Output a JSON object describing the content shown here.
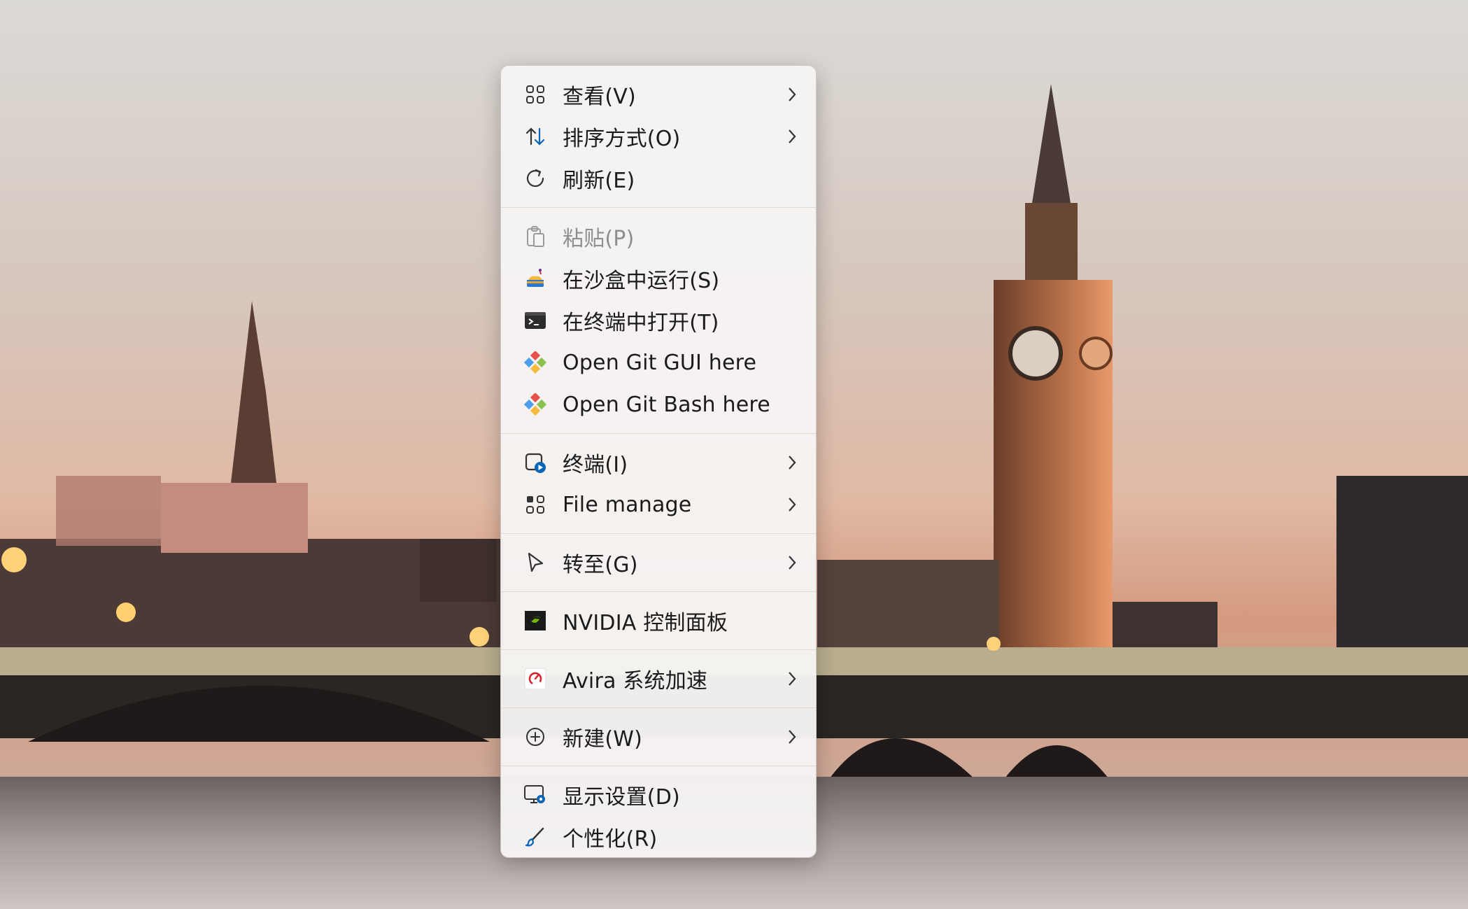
{
  "context_menu": {
    "groups": [
      {
        "items": [
          {
            "label": "查看(V)",
            "icon": "view-grid-icon",
            "submenu": true
          },
          {
            "label": "排序方式(O)",
            "icon": "sort-arrows-icon",
            "submenu": true
          },
          {
            "label": "刷新(E)",
            "icon": "refresh-icon",
            "submenu": false
          }
        ]
      },
      {
        "items": [
          {
            "label": "粘贴(P)",
            "icon": "paste-icon",
            "submenu": false,
            "disabled": true
          },
          {
            "label": "在沙盒中运行(S)",
            "icon": "sandbox-icon",
            "submenu": false
          },
          {
            "label": "在终端中打开(T)",
            "icon": "terminal-icon",
            "submenu": false
          },
          {
            "label": "Open Git GUI here",
            "icon": "git-icon",
            "submenu": false
          },
          {
            "label": "Open Git Bash here",
            "icon": "git-icon",
            "submenu": false
          }
        ]
      },
      {
        "items": [
          {
            "label": "终端(I)",
            "icon": "terminal-play-icon",
            "submenu": true
          },
          {
            "label": "File manage",
            "icon": "file-manage-grid-icon",
            "submenu": true
          }
        ]
      },
      {
        "items": [
          {
            "label": "转至(G)",
            "icon": "cursor-arrow-icon",
            "submenu": true
          }
        ]
      },
      {
        "items": [
          {
            "label": "NVIDIA 控制面板",
            "icon": "nvidia-icon",
            "submenu": false
          }
        ]
      },
      {
        "items": [
          {
            "label": "Avira 系统加速",
            "icon": "avira-gauge-icon",
            "submenu": true
          }
        ]
      },
      {
        "items": [
          {
            "label": "新建(W)",
            "icon": "new-plus-icon",
            "submenu": true
          }
        ]
      },
      {
        "items": [
          {
            "label": "显示设置(D)",
            "icon": "display-settings-icon",
            "submenu": false
          },
          {
            "label": "个性化(R)",
            "icon": "personalize-brush-icon",
            "submenu": false
          }
        ]
      }
    ]
  },
  "colors": {
    "menu_bg": "#f6f4f3",
    "text": "#1b1b1b",
    "disabled_text": "#8f8f8f",
    "accent_blue": "#0a64b8",
    "nvidia_green": "#76b900",
    "avira_red": "#d7232f"
  }
}
